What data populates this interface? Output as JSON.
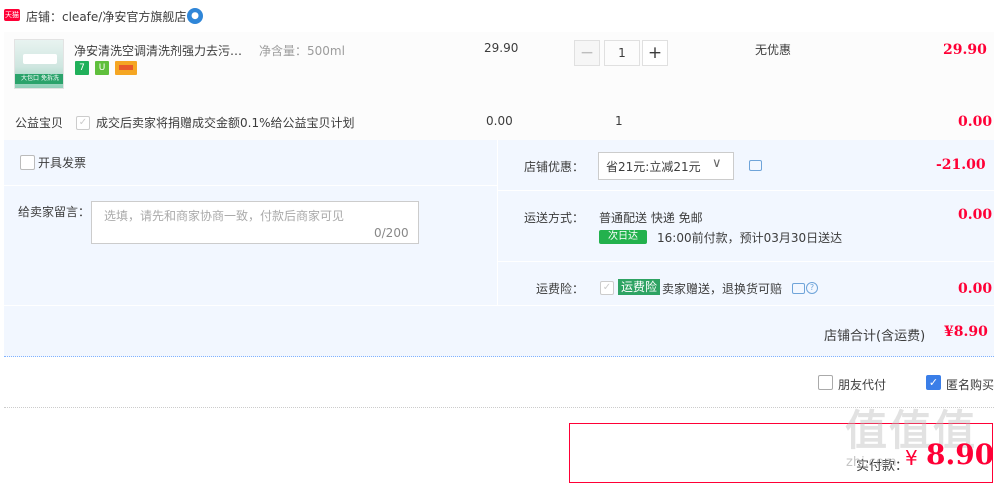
{
  "shop": {
    "badge": "天猫",
    "label": "店铺：cleafe/净安官方旗舰店",
    "ww": "●"
  },
  "item": {
    "title": "净安清洗空调清洗剂强力去污清洁剂",
    "sku": "净含量：500ml",
    "thumb_banner": "大包口 免拆洗",
    "badges": [
      "7",
      "U"
    ],
    "price": "29.90",
    "quantity": "1",
    "qty_minus": "−",
    "qty_plus": "+",
    "discount": "无优惠",
    "subtotal": "29.90"
  },
  "charity": {
    "label": "公益宝贝",
    "check": "✓",
    "text": "成交后卖家将捐赠成交金额0.1%给公益宝贝计划",
    "price": "0.00",
    "quantity": "1",
    "subtotal": "0.00"
  },
  "invoice": {
    "label": "开具发票"
  },
  "memo": {
    "label": "给卖家留言：",
    "placeholder": "选填，请先和商家协商一致，付款后商家可见",
    "count": "0/200"
  },
  "coupon": {
    "label": "店铺优惠：",
    "value": "省21元:立减21元",
    "chevron": "∨",
    "amount": "-21.00"
  },
  "shipping": {
    "label": "运送方式：",
    "method": "普通配送 快递 免邮",
    "nextday": "次日达",
    "eta": "16:00前付款，预计03月30日送达",
    "amount": "0.00"
  },
  "insurance": {
    "label": "运费险：",
    "check": "✓",
    "tag": "运费险",
    "text": "卖家赠送，退换货可赔",
    "help": "?",
    "amount": "0.00"
  },
  "total": {
    "label": "店铺合计(含运费)",
    "amount": "¥8.90"
  },
  "options": {
    "friend_pay": "朋友代付",
    "anonymous": "匿名购买",
    "anon_check": "✓"
  },
  "payment": {
    "label": "实付款：",
    "yen": "¥",
    "amount": "8.90"
  },
  "watermark": {
    "text": "值值值",
    "url": "zhi.com"
  },
  "colors": {
    "accent": "#ff0036",
    "panel": "#f2f7ff",
    "blue_check": "#3a7ee8",
    "green": "#2ea363"
  }
}
